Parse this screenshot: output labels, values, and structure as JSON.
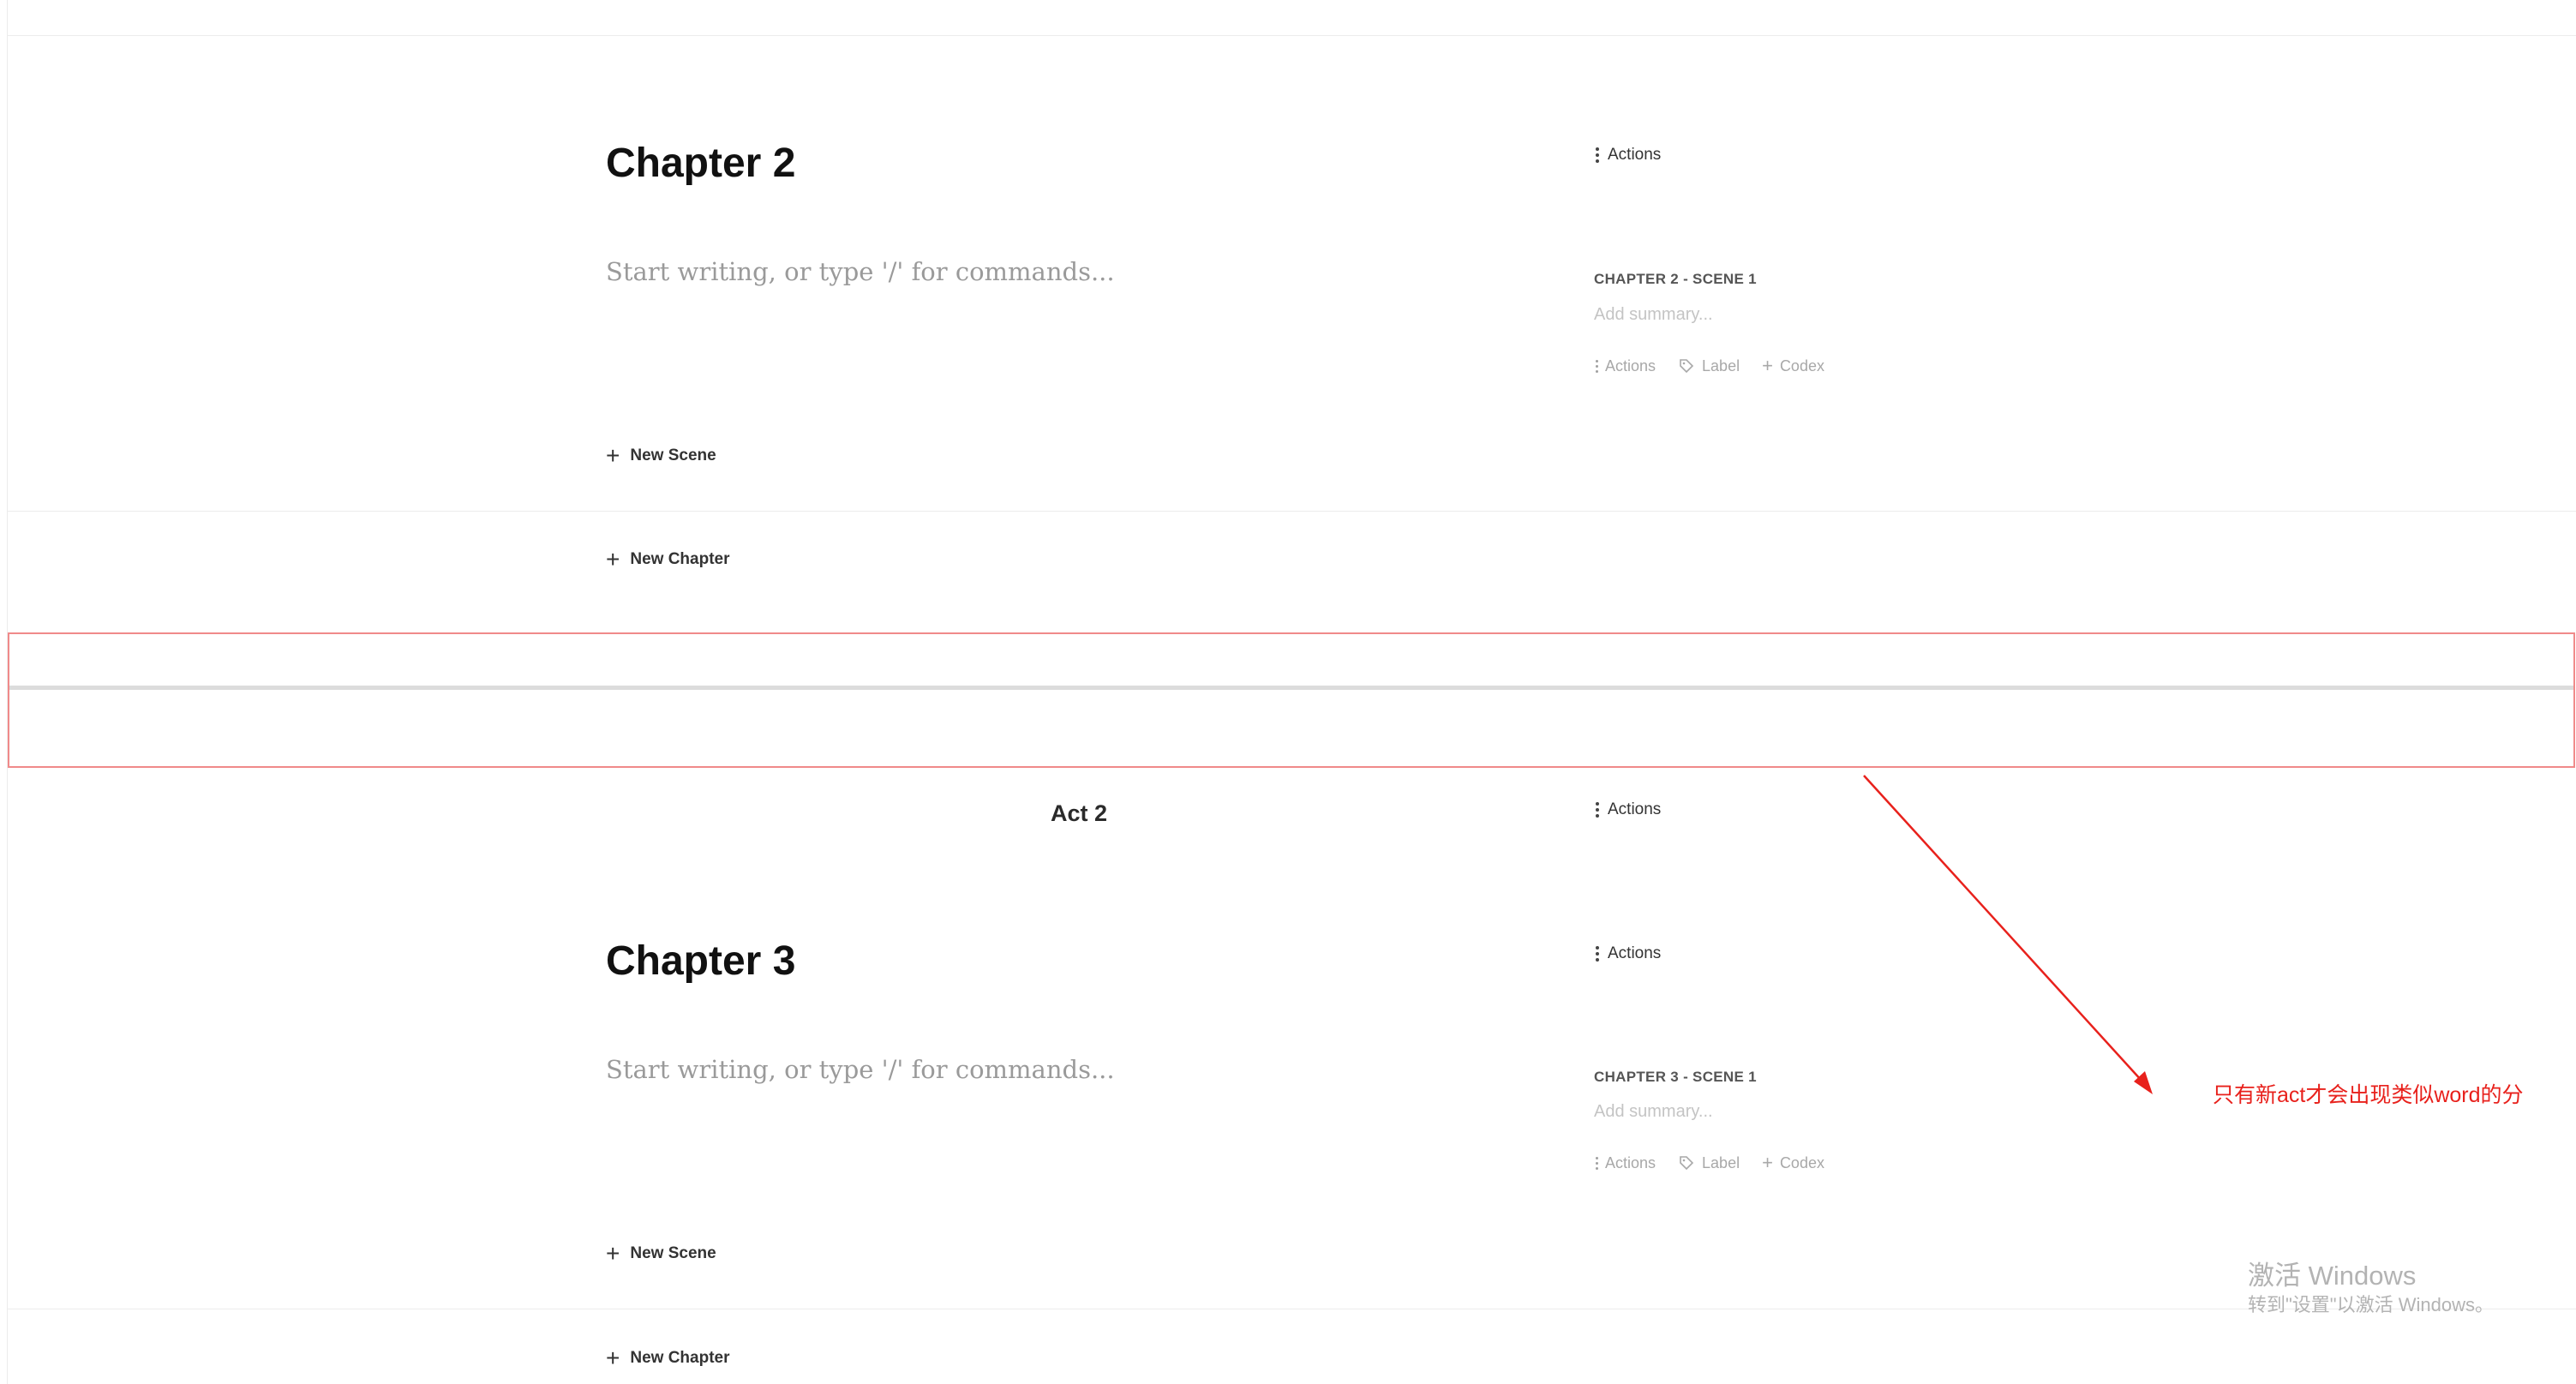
{
  "chapter2": {
    "title": "Chapter 2",
    "actions_label": "Actions",
    "editor_placeholder": "Start writing, or type '/' for commands...",
    "scene": {
      "heading": "CHAPTER 2 - SCENE 1",
      "summary_placeholder": "Add summary...",
      "actions_label": "Actions",
      "label_label": "Label",
      "codex_label": "Codex"
    },
    "new_scene_label": "New Scene"
  },
  "new_chapter_label_1": "New Chapter",
  "act2": {
    "title": "Act 2",
    "actions_label": "Actions"
  },
  "chapter3": {
    "title": "Chapter 3",
    "actions_label": "Actions",
    "editor_placeholder": "Start writing, or type '/' for commands...",
    "scene": {
      "heading": "CHAPTER 3 - SCENE 1",
      "summary_placeholder": "Add summary...",
      "actions_label": "Actions",
      "label_label": "Label",
      "codex_label": "Codex"
    },
    "new_scene_label": "New Scene"
  },
  "new_chapter_label_2": "New Chapter",
  "annotation": {
    "text": "只有新act才会出现类似word的分",
    "color": "#e8211c"
  },
  "watermark": {
    "line1": "激活 Windows",
    "line2": "转到\"设置\"以激活 Windows。"
  }
}
